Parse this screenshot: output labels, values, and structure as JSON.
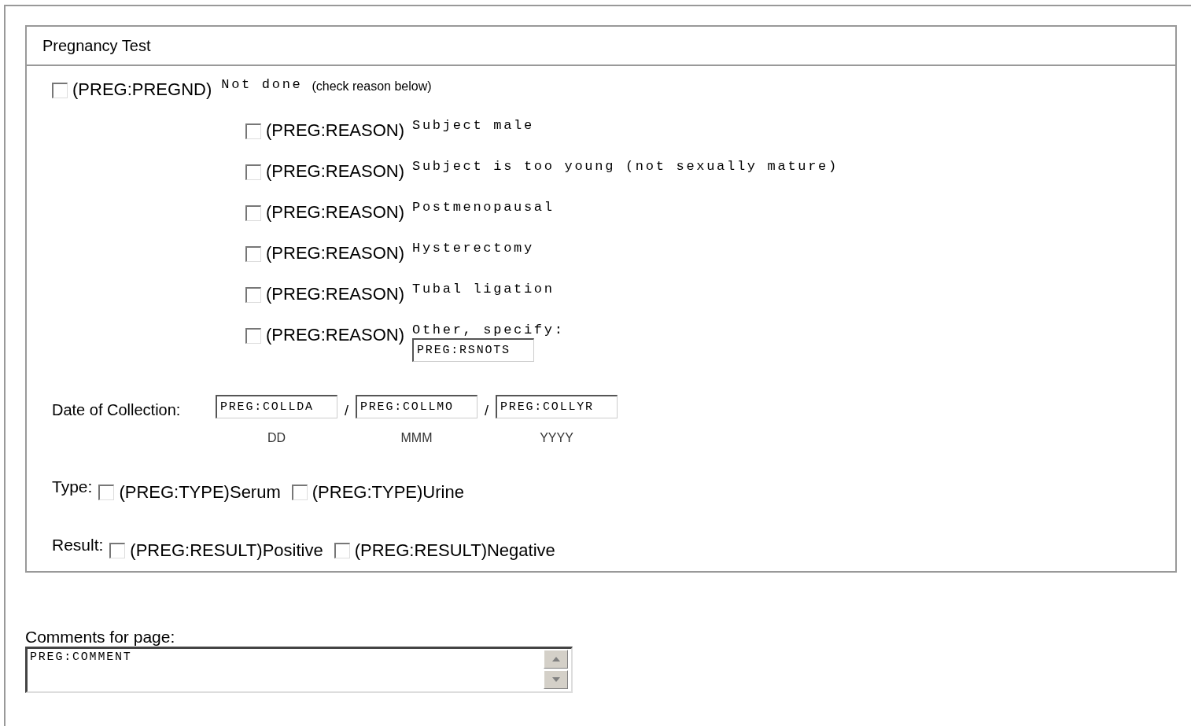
{
  "panel": {
    "title": "Pregnancy Test",
    "not_done": {
      "checked": false,
      "code": "(PREG:PREGND)",
      "label": "Not done",
      "hint": "(check reason below)"
    },
    "reasons": [
      {
        "checked": false,
        "code": "(PREG:REASON)",
        "label": "Subject male"
      },
      {
        "checked": false,
        "code": "(PREG:REASON)",
        "label": "Subject is too young (not sexually mature)"
      },
      {
        "checked": false,
        "code": "(PREG:REASON)",
        "label": "Postmenopausal"
      },
      {
        "checked": false,
        "code": "(PREG:REASON)",
        "label": "Hysterectomy"
      },
      {
        "checked": false,
        "code": "(PREG:REASON)",
        "label": "Tubal ligation"
      },
      {
        "checked": false,
        "code": "(PREG:REASON)",
        "label": "Other, specify:",
        "field": {
          "value": "PREG:RSNOTS"
        }
      }
    ],
    "date": {
      "label": "Date of Collection:",
      "fields": [
        {
          "value": "PREG:COLLDA",
          "caption": "DD"
        },
        {
          "value": "PREG:COLLMO",
          "caption": "MMM"
        },
        {
          "value": "PREG:COLLYR",
          "caption": "YYYY"
        }
      ],
      "separators": [
        "/",
        "/"
      ]
    },
    "type": {
      "label": "Type:",
      "options": [
        {
          "checked": false,
          "code": "(PREG:TYPE)",
          "label": "Serum"
        },
        {
          "checked": false,
          "code": "(PREG:TYPE)",
          "label": "Urine"
        }
      ]
    },
    "result": {
      "label": "Result:",
      "options": [
        {
          "checked": false,
          "code": "(PREG:RESULT)",
          "label": "Positive"
        },
        {
          "checked": false,
          "code": "(PREG:RESULT)",
          "label": "Negative"
        }
      ]
    }
  },
  "comments": {
    "label": "Comments for page:",
    "value": "PREG:COMMENT"
  }
}
